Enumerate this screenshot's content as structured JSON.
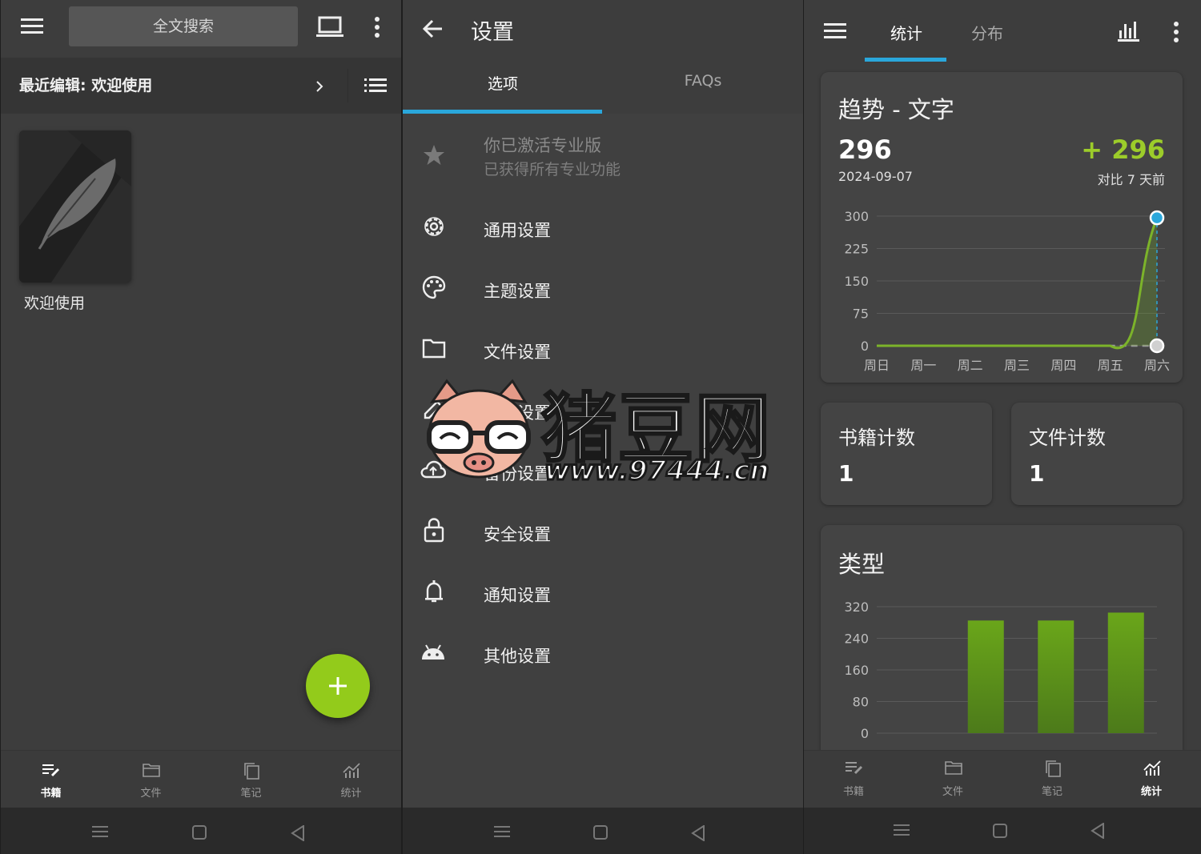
{
  "panel1": {
    "search_placeholder": "全文搜索",
    "recent_label": "最近编辑: 欢迎使用",
    "book_title": "欢迎使用",
    "nav": [
      "书籍",
      "文件",
      "笔记",
      "统计"
    ]
  },
  "panel2": {
    "title": "设置",
    "tabs": [
      "选项",
      "FAQs"
    ],
    "pro_title": "你已激活专业版",
    "pro_subtitle": "已获得所有专业功能",
    "items": [
      "通用设置",
      "主题设置",
      "文件设置",
      "编辑设置",
      "备份设置",
      "安全设置",
      "通知设置",
      "其他设置"
    ]
  },
  "panel3": {
    "tabs": [
      "统计",
      "分布"
    ],
    "trend_title": "趋势 - 文字",
    "trend_value": "296",
    "trend_date": "2024-09-07",
    "trend_delta": "+ 296",
    "trend_compare": "对比 7 天前",
    "book_count_label": "书籍计数",
    "book_count": "1",
    "file_count_label": "文件计数",
    "file_count": "1",
    "type_title": "类型",
    "nav": [
      "书籍",
      "文件",
      "笔记",
      "统计"
    ]
  },
  "chart_data": [
    {
      "type": "line",
      "categories": [
        "周日",
        "周一",
        "周二",
        "周三",
        "周四",
        "周五",
        "周六"
      ],
      "series": [
        {
          "values": [
            0,
            0,
            0,
            0,
            0,
            0,
            296
          ]
        }
      ],
      "yticks": [
        0,
        75,
        150,
        225,
        300
      ],
      "ylim": [
        0,
        300
      ]
    },
    {
      "type": "bar",
      "categories": [
        "",
        "",
        "",
        ""
      ],
      "values": [
        0,
        285,
        285,
        305
      ],
      "yticks": [
        0,
        80,
        160,
        240,
        320
      ],
      "ylim": [
        0,
        320
      ]
    }
  ],
  "watermark": {
    "brand": "猪豆网",
    "url": "www.97444.cn"
  },
  "colors": {
    "accent_blue": "#2aa7db",
    "accent_green": "#93cb1b",
    "delta_green": "#9ccc2a"
  }
}
